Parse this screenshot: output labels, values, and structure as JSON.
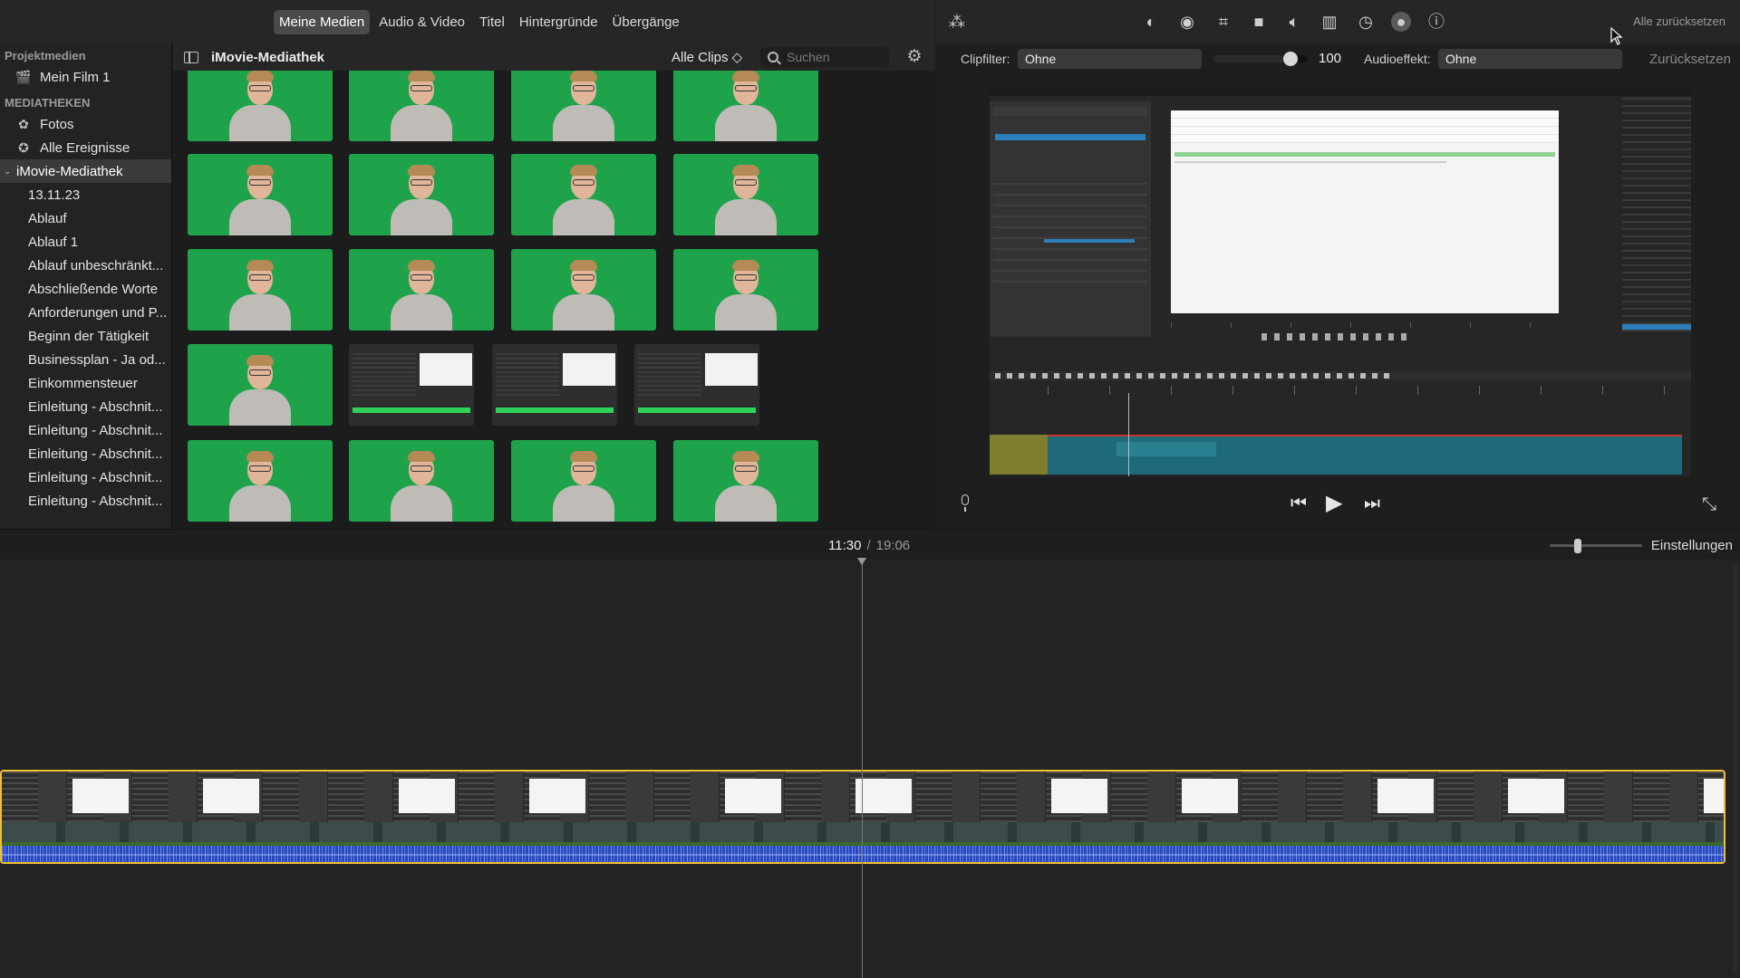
{
  "tabs": [
    {
      "label": "Meine Medien",
      "active": true
    },
    {
      "label": "Audio & Video"
    },
    {
      "label": "Titel"
    },
    {
      "label": "Hintergründe"
    },
    {
      "label": "Übergänge"
    }
  ],
  "sidebar": {
    "project_heading": "Projektmedien",
    "project_item": "Mein Film 1",
    "libraries_heading": "MEDIATHEKEN",
    "fotos": "Fotos",
    "events": "Alle Ereignisse",
    "library": "iMovie-Mediathek",
    "items": [
      "13.11.23",
      "Ablauf",
      "Ablauf 1",
      "Ablauf unbeschränkt...",
      "Abschließende Worte",
      "Anforderungen und P...",
      "Beginn der Tätigkeit",
      "Businessplan - Ja od...",
      "Einkommensteuer",
      "Einleitung - Abschnit...",
      "Einleitung - Abschnit...",
      "Einleitung - Abschnit...",
      "Einleitung - Abschnit...",
      "Einleitung - Abschnit..."
    ]
  },
  "browser": {
    "title": "iMovie-Mediathek",
    "filter": "Alle Clips ◇",
    "search_placeholder": "Suchen"
  },
  "viewer": {
    "reset_all": "Alle zurücksetzen",
    "clip_filter_label": "Clipfilter:",
    "clip_filter_value": "Ohne",
    "intensity": "100",
    "intensity_fraction": 0.82,
    "audio_effect_label": "Audioeffekt:",
    "audio_effect_value": "Ohne",
    "reset": "Zurücksetzen"
  },
  "timeline": {
    "current": "11:30",
    "separator": "/",
    "total": "19:06",
    "settings": "Einstellungen",
    "zoom_fraction": 0.3
  },
  "icons": {
    "magic": "magic-wand-icon",
    "color_balance": "color-balance-icon",
    "color_correction": "palette-icon",
    "crop": "crop-icon",
    "stabilize": "camera-icon",
    "volume": "speaker-icon",
    "equalizer": "equalizer-icon",
    "speed": "speedometer-icon",
    "clip_filter": "clip-filter-icon",
    "info": "info-icon"
  },
  "colors": {
    "green_screen": "#1fa34a",
    "timeline_selection": "#f0c030",
    "audio_wave": "#2b49b8"
  }
}
